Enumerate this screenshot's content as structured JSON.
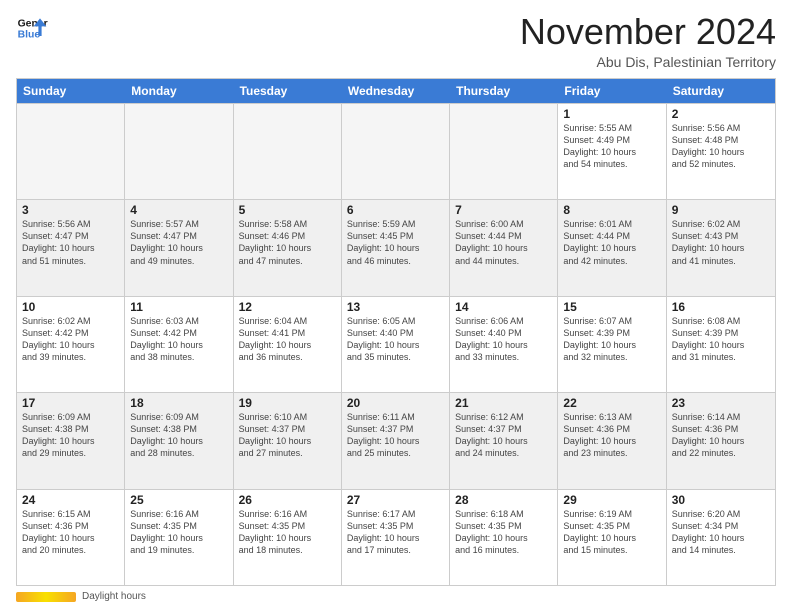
{
  "logo": {
    "line1": "General",
    "line2": "Blue"
  },
  "title": "November 2024",
  "location": "Abu Dis, Palestinian Territory",
  "days_of_week": [
    "Sunday",
    "Monday",
    "Tuesday",
    "Wednesday",
    "Thursday",
    "Friday",
    "Saturday"
  ],
  "footer": {
    "daylight_label": "Daylight hours"
  },
  "weeks": [
    [
      {
        "num": "",
        "info": "",
        "empty": true
      },
      {
        "num": "",
        "info": "",
        "empty": true
      },
      {
        "num": "",
        "info": "",
        "empty": true
      },
      {
        "num": "",
        "info": "",
        "empty": true
      },
      {
        "num": "",
        "info": "",
        "empty": true
      },
      {
        "num": "1",
        "info": "Sunrise: 5:55 AM\nSunset: 4:49 PM\nDaylight: 10 hours\nand 54 minutes."
      },
      {
        "num": "2",
        "info": "Sunrise: 5:56 AM\nSunset: 4:48 PM\nDaylight: 10 hours\nand 52 minutes."
      }
    ],
    [
      {
        "num": "3",
        "info": "Sunrise: 5:56 AM\nSunset: 4:47 PM\nDaylight: 10 hours\nand 51 minutes."
      },
      {
        "num": "4",
        "info": "Sunrise: 5:57 AM\nSunset: 4:47 PM\nDaylight: 10 hours\nand 49 minutes."
      },
      {
        "num": "5",
        "info": "Sunrise: 5:58 AM\nSunset: 4:46 PM\nDaylight: 10 hours\nand 47 minutes."
      },
      {
        "num": "6",
        "info": "Sunrise: 5:59 AM\nSunset: 4:45 PM\nDaylight: 10 hours\nand 46 minutes."
      },
      {
        "num": "7",
        "info": "Sunrise: 6:00 AM\nSunset: 4:44 PM\nDaylight: 10 hours\nand 44 minutes."
      },
      {
        "num": "8",
        "info": "Sunrise: 6:01 AM\nSunset: 4:44 PM\nDaylight: 10 hours\nand 42 minutes."
      },
      {
        "num": "9",
        "info": "Sunrise: 6:02 AM\nSunset: 4:43 PM\nDaylight: 10 hours\nand 41 minutes."
      }
    ],
    [
      {
        "num": "10",
        "info": "Sunrise: 6:02 AM\nSunset: 4:42 PM\nDaylight: 10 hours\nand 39 minutes."
      },
      {
        "num": "11",
        "info": "Sunrise: 6:03 AM\nSunset: 4:42 PM\nDaylight: 10 hours\nand 38 minutes."
      },
      {
        "num": "12",
        "info": "Sunrise: 6:04 AM\nSunset: 4:41 PM\nDaylight: 10 hours\nand 36 minutes."
      },
      {
        "num": "13",
        "info": "Sunrise: 6:05 AM\nSunset: 4:40 PM\nDaylight: 10 hours\nand 35 minutes."
      },
      {
        "num": "14",
        "info": "Sunrise: 6:06 AM\nSunset: 4:40 PM\nDaylight: 10 hours\nand 33 minutes."
      },
      {
        "num": "15",
        "info": "Sunrise: 6:07 AM\nSunset: 4:39 PM\nDaylight: 10 hours\nand 32 minutes."
      },
      {
        "num": "16",
        "info": "Sunrise: 6:08 AM\nSunset: 4:39 PM\nDaylight: 10 hours\nand 31 minutes."
      }
    ],
    [
      {
        "num": "17",
        "info": "Sunrise: 6:09 AM\nSunset: 4:38 PM\nDaylight: 10 hours\nand 29 minutes."
      },
      {
        "num": "18",
        "info": "Sunrise: 6:09 AM\nSunset: 4:38 PM\nDaylight: 10 hours\nand 28 minutes."
      },
      {
        "num": "19",
        "info": "Sunrise: 6:10 AM\nSunset: 4:37 PM\nDaylight: 10 hours\nand 27 minutes."
      },
      {
        "num": "20",
        "info": "Sunrise: 6:11 AM\nSunset: 4:37 PM\nDaylight: 10 hours\nand 25 minutes."
      },
      {
        "num": "21",
        "info": "Sunrise: 6:12 AM\nSunset: 4:37 PM\nDaylight: 10 hours\nand 24 minutes."
      },
      {
        "num": "22",
        "info": "Sunrise: 6:13 AM\nSunset: 4:36 PM\nDaylight: 10 hours\nand 23 minutes."
      },
      {
        "num": "23",
        "info": "Sunrise: 6:14 AM\nSunset: 4:36 PM\nDaylight: 10 hours\nand 22 minutes."
      }
    ],
    [
      {
        "num": "24",
        "info": "Sunrise: 6:15 AM\nSunset: 4:36 PM\nDaylight: 10 hours\nand 20 minutes."
      },
      {
        "num": "25",
        "info": "Sunrise: 6:16 AM\nSunset: 4:35 PM\nDaylight: 10 hours\nand 19 minutes."
      },
      {
        "num": "26",
        "info": "Sunrise: 6:16 AM\nSunset: 4:35 PM\nDaylight: 10 hours\nand 18 minutes."
      },
      {
        "num": "27",
        "info": "Sunrise: 6:17 AM\nSunset: 4:35 PM\nDaylight: 10 hours\nand 17 minutes."
      },
      {
        "num": "28",
        "info": "Sunrise: 6:18 AM\nSunset: 4:35 PM\nDaylight: 10 hours\nand 16 minutes."
      },
      {
        "num": "29",
        "info": "Sunrise: 6:19 AM\nSunset: 4:35 PM\nDaylight: 10 hours\nand 15 minutes."
      },
      {
        "num": "30",
        "info": "Sunrise: 6:20 AM\nSunset: 4:34 PM\nDaylight: 10 hours\nand 14 minutes."
      }
    ]
  ]
}
